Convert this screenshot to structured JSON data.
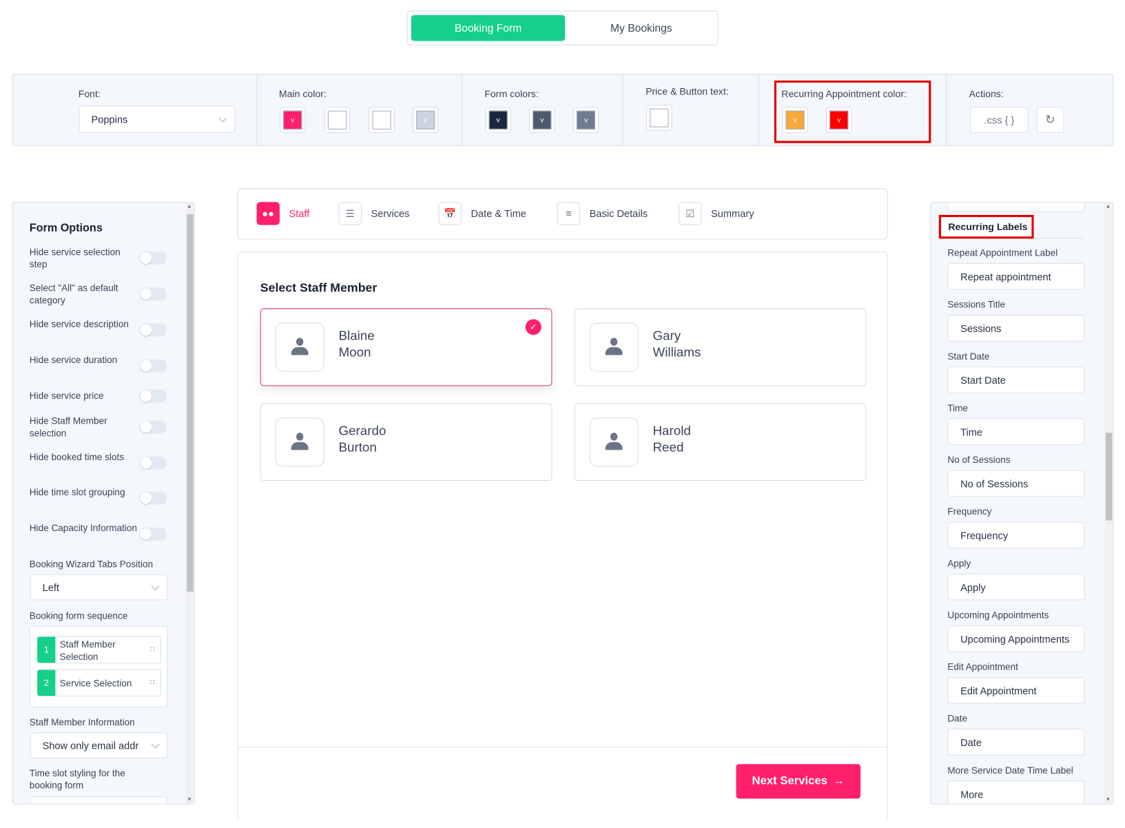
{
  "top_tabs": {
    "booking_form": "Booking Form",
    "my_bookings": "My Bookings"
  },
  "toolbar": {
    "font_label": "Font:",
    "font_value": "Poppins",
    "main_color_label": "Main color:",
    "main_colors": [
      "#ff1f6b",
      "#ffffff",
      "#ffffff",
      "#cdd3e0"
    ],
    "form_colors_label": "Form colors:",
    "form_colors": [
      "#1a2740",
      "#4f5a6e",
      "#707b90"
    ],
    "price_label": "Price & Button text:",
    "price_color": "#ffffff",
    "recurring_label": "Recurring Appointment color:",
    "recurring_colors": [
      "#f5a93b",
      "#ff0000"
    ],
    "actions_label": "Actions:",
    "css_button": ".css { }",
    "reset_icon": "refresh-icon"
  },
  "left_panel": {
    "title": "Form Options",
    "options": [
      {
        "label": "Hide service selection step",
        "on": false
      },
      {
        "label": "Select \"All\" as default category",
        "on": false
      },
      {
        "label": "Hide service description",
        "on": false
      },
      {
        "label": "Hide service duration",
        "on": false
      },
      {
        "label": "Hide service price",
        "on": false
      },
      {
        "label": "Hide Staff Member selection",
        "on": false
      },
      {
        "label": "Hide booked time slots",
        "on": false
      },
      {
        "label": "Hide time slot grouping",
        "on": false
      },
      {
        "label": "Hide Capacity Information",
        "on": false
      }
    ],
    "tabs_position_label": "Booking Wizard Tabs Position",
    "tabs_position_value": "Left",
    "sequence_label": "Booking form sequence",
    "sequence": [
      {
        "num": "1",
        "label": "Staff Member Selection"
      },
      {
        "num": "2",
        "label": "Service Selection"
      }
    ],
    "staff_info_label": "Staff Member Information",
    "staff_info_value": "Show only email addr",
    "time_slot_label": "Time slot styling for the booking form"
  },
  "wizard_tabs": [
    {
      "label": "Staff",
      "icon": "users-icon",
      "active": true
    },
    {
      "label": "Services",
      "icon": "list-icon"
    },
    {
      "label": "Date & Time",
      "icon": "calendar-icon"
    },
    {
      "label": "Basic Details",
      "icon": "document-icon"
    },
    {
      "label": "Summary",
      "icon": "clipboard-check-icon"
    }
  ],
  "main": {
    "title": "Select Staff Member",
    "staff": [
      {
        "first": "Blaine",
        "last": "Moon",
        "selected": true
      },
      {
        "first": "Gary",
        "last": "Williams"
      },
      {
        "first": "Gerardo",
        "last": "Burton"
      },
      {
        "first": "Harold",
        "last": "Reed"
      }
    ],
    "next_button": "Next Services"
  },
  "right_panel": {
    "section_title": "Recurring Labels",
    "fields": [
      {
        "label": "Repeat Appointment Label",
        "value": "Repeat appointment"
      },
      {
        "label": "Sessions Title",
        "value": "Sessions"
      },
      {
        "label": "Start Date",
        "value": "Start Date"
      },
      {
        "label": "Time",
        "value": "Time"
      },
      {
        "label": "No of Sessions",
        "value": "No of Sessions"
      },
      {
        "label": "Frequency",
        "value": "Frequency"
      },
      {
        "label": "Apply",
        "value": "Apply"
      },
      {
        "label": "Upcoming Appointments",
        "value": "Upcoming Appointments"
      },
      {
        "label": "Edit Appointment",
        "value": "Edit Appointment"
      },
      {
        "label": "Date",
        "value": "Date"
      },
      {
        "label": "More Service Date Time Label",
        "value": "More"
      }
    ]
  },
  "colors": {
    "accent": "#ff1f6b",
    "green": "#14d08a",
    "highlight": "#e00000"
  }
}
